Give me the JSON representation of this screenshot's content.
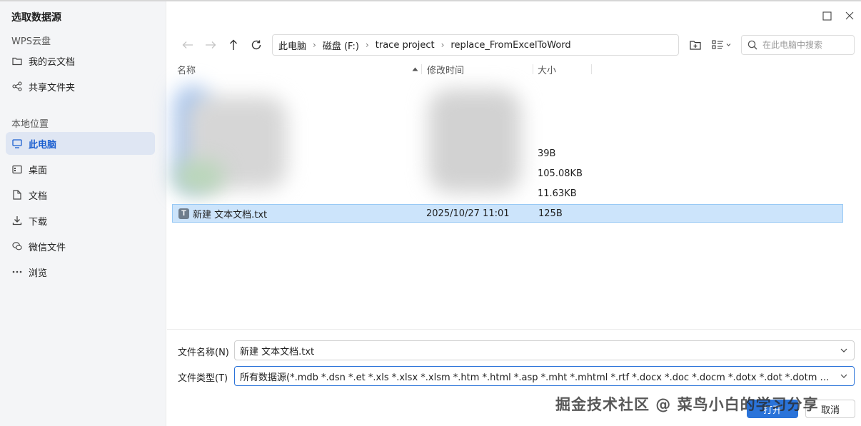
{
  "dialog": {
    "title": "选取数据源"
  },
  "sidebar": {
    "cloud_section": "WPS云盘",
    "cloud_items": [
      {
        "label": "我的云文档",
        "icon": "folder-icon"
      },
      {
        "label": "共享文件夹",
        "icon": "share-icon"
      }
    ],
    "local_section": "本地位置",
    "local_items": [
      {
        "label": "此电脑",
        "icon": "computer-icon",
        "active": true
      },
      {
        "label": "桌面",
        "icon": "desktop-icon"
      },
      {
        "label": "文档",
        "icon": "document-icon"
      },
      {
        "label": "下载",
        "icon": "download-icon"
      },
      {
        "label": "微信文件",
        "icon": "wechat-icon"
      },
      {
        "label": "浏览",
        "icon": "more-icon"
      }
    ]
  },
  "breadcrumb": [
    "此电脑",
    "磁盘 (F:)",
    "trace project",
    "replace_FromExcelToWord"
  ],
  "search": {
    "placeholder": "在此电脑中搜索"
  },
  "columns": {
    "name": "名称",
    "modified": "修改时间",
    "size": "大小"
  },
  "files": [
    {
      "name": "",
      "modified": "",
      "size": "39B",
      "blurred": true
    },
    {
      "name": "",
      "modified": "",
      "size": "105.08KB",
      "blurred": true
    },
    {
      "name": "",
      "modified": "",
      "size": "11.63KB",
      "blurred": true
    },
    {
      "name": "新建 文本文档.txt",
      "modified": "2025/10/27 11:01",
      "size": "125B",
      "selected": true,
      "icon": "text-file-icon"
    }
  ],
  "filename": {
    "label": "文件名称(N)",
    "value": "新建 文本文档.txt"
  },
  "filetype": {
    "label": "文件类型(T)",
    "value": "所有数据源(*.mdb *.dsn *.et *.xls *.xlsx *.xlsm *.htm *.html *.asp *.mht *.mhtml *.rtf *.docx *.doc *.docm *.dotx *.dot *.dotm *.txt *.csv *.prn *.dbf *.odc *.udl)"
  },
  "buttons": {
    "open": "打开",
    "cancel": "取消"
  },
  "watermark": "掘金技术社区 @ 菜鸟小白的学习分享",
  "colors": {
    "accent": "#2a73d9",
    "selected_row": "#cce4fb",
    "sidebar_bg": "#f4f5f7",
    "sidebar_active": "#dfe6f3"
  }
}
